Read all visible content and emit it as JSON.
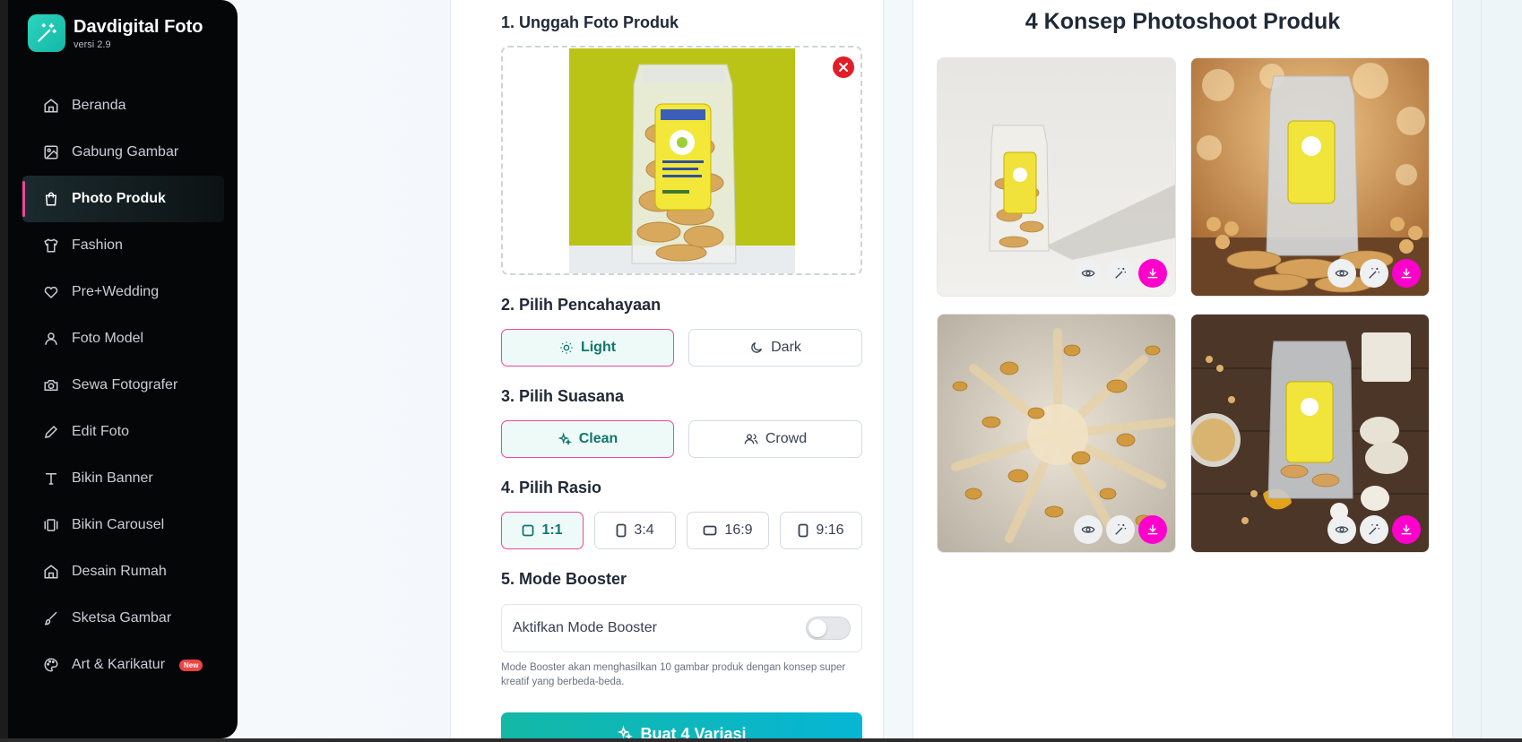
{
  "app": {
    "name": "Davdigital Foto",
    "version": "versi 2.9"
  },
  "sidebar": {
    "items": [
      {
        "label": "Beranda",
        "icon": "home-icon",
        "active": false
      },
      {
        "label": "Gabung Gambar",
        "icon": "image-icon",
        "active": false
      },
      {
        "label": "Photo Produk",
        "icon": "shopping-bag-icon",
        "active": true
      },
      {
        "label": "Fashion",
        "icon": "shirt-icon",
        "active": false
      },
      {
        "label": "Pre+Wedding",
        "icon": "heart-icon",
        "active": false
      },
      {
        "label": "Foto Model",
        "icon": "user-icon",
        "active": false
      },
      {
        "label": "Sewa Fotografer",
        "icon": "camera-icon",
        "active": false
      },
      {
        "label": "Edit Foto",
        "icon": "pencil-icon",
        "active": false
      },
      {
        "label": "Bikin Banner",
        "icon": "type-icon",
        "active": false
      },
      {
        "label": "Bikin Carousel",
        "icon": "carousel-icon",
        "active": false
      },
      {
        "label": "Desain Rumah",
        "icon": "home-icon",
        "active": false
      },
      {
        "label": "Sketsa Gambar",
        "icon": "brush-icon",
        "active": false
      },
      {
        "label": "Art & Karikatur",
        "icon": "palette-icon",
        "active": false,
        "badge": "New"
      }
    ]
  },
  "form": {
    "upload_title": "1. Unggah Foto Produk",
    "lighting_title": "2. Pilih Pencahayaan",
    "lighting_options": [
      {
        "label": "Light",
        "icon": "sun-icon",
        "selected": true
      },
      {
        "label": "Dark",
        "icon": "moon-icon",
        "selected": false
      }
    ],
    "mood_title": "3. Pilih Suasana",
    "mood_options": [
      {
        "label": "Clean",
        "icon": "sparkles-icon",
        "selected": true
      },
      {
        "label": "Crowd",
        "icon": "users-icon",
        "selected": false
      }
    ],
    "ratio_title": "4. Pilih Rasio",
    "ratio_options": [
      {
        "label": "1:1",
        "icon": "square-icon",
        "selected": true
      },
      {
        "label": "3:4",
        "icon": "portrait-icon",
        "selected": false
      },
      {
        "label": "16:9",
        "icon": "landscape-icon",
        "selected": false
      },
      {
        "label": "9:16",
        "icon": "portrait-icon",
        "selected": false
      }
    ],
    "booster_title": "5. Mode Booster",
    "booster_label": "Aktifkan Mode Booster",
    "booster_enabled": false,
    "booster_note": "Mode Booster akan menghasilkan 10 gambar produk dengan konsep super kreatif yang berbeda-beda.",
    "generate_label": "Buat 4 Variasi"
  },
  "results": {
    "title": "4 Konsep Photoshoot Produk",
    "cards": [
      {
        "concept": "clean-light-shadow"
      },
      {
        "concept": "bokeh-wood-soybeans"
      },
      {
        "concept": "chips-explosion"
      },
      {
        "concept": "tempeh-soybeans-flatlay"
      }
    ],
    "actions": [
      "eye-icon",
      "magic-wand-icon",
      "download-icon"
    ]
  },
  "colors": {
    "accent": "#ec4899",
    "teal": "#14b8a6",
    "download": "#ff00cc",
    "sidebar_bg": "#050608"
  }
}
